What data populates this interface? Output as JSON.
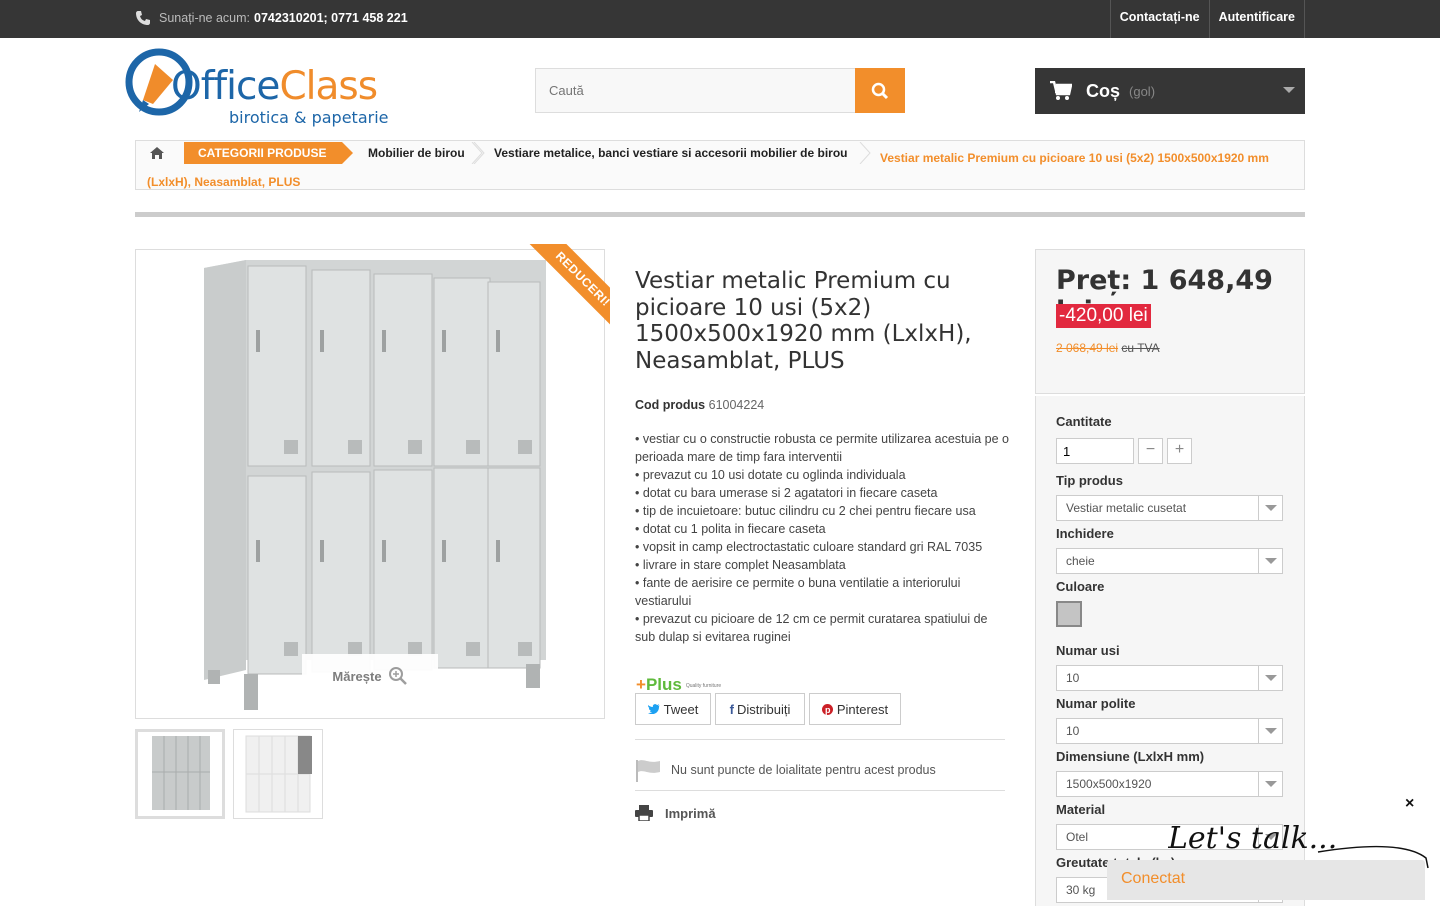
{
  "topbar": {
    "call_label": "Sunați-ne acum:",
    "phones": "0742310201; 0771 458 221",
    "contact_link": "Contactați-ne",
    "login_link": "Autentificare"
  },
  "logo": {
    "office": "Office",
    "class": "Class",
    "tagline": "birotica & papetarie"
  },
  "search": {
    "placeholder": "Caută"
  },
  "cart": {
    "label": "Coș",
    "count": "(gol)"
  },
  "breadcrumb": {
    "categories": "CATEGORII PRODUSE",
    "item1": "Mobilier de birou",
    "item2": "Vestiare metalice, banci vestiare si accesorii mobilier de birou",
    "current": "Vestiar metalic Premium cu picioare 10 usi (5x2) 1500x500x1920 mm (LxlxH), Neasamblat, PLUS"
  },
  "gallery": {
    "ribbon": "REDUCERI!",
    "zoom_label": "Mărește"
  },
  "product": {
    "title": "Vestiar metalic Premium cu picioare 10 usi (5x2) 1500x500x1920 mm (LxlxH), Neasamblat, PLUS",
    "code_label": "Cod produs",
    "code_value": "61004224",
    "description": [
      "• vestiar cu o constructie robusta ce permite utilizarea acestuia pe o perioada mare de timp fara interventii",
      "• prevazut cu 10 usi dotate cu oglinda individuala",
      "• dotat cu bara umerase si 2 agatatori in fiecare caseta",
      "• tip de incuietoare: butuc cilindru cu 2 chei pentru fiecare usa",
      "• dotat cu 1 polita in fiecare caseta",
      "• vopsit in camp electroctastatic culoare standard gri RAL 7035",
      "• livrare in stare complet Neasamblata",
      "• fante de aerisire ce permite o buna ventilatie a interiorului vestiarului",
      "• prevazut cu picioare de 12 cm ce permit curatarea spatiului de sub dulap si evitarea ruginei"
    ],
    "brand_logo": "Plus",
    "brand_tagline": "Quality furniture",
    "share": {
      "tweet": "Tweet",
      "share": "Distribuiți",
      "pinterest": "Pinterest"
    },
    "loyalty_text": "Nu sunt puncte de loialitate pentru acest produs",
    "print_label": "Imprimă"
  },
  "price": {
    "current": "Preț: 1 648,49 lei",
    "discount": "-420,00 lei",
    "old": "2 068,49 lei",
    "vat": "cu TVA"
  },
  "options": {
    "quantity_label": "Cantitate",
    "quantity_value": "1",
    "tip_label": "Tip produs",
    "tip_value": "Vestiar metalic cusetat",
    "inchidere_label": "Inchidere",
    "inchidere_value": "cheie",
    "culoare_label": "Culoare",
    "culoare_swatch": "#c4c4c4",
    "usi_label": "Numar usi",
    "usi_value": "10",
    "polite_label": "Numar polite",
    "polite_value": "10",
    "dim_label": "Dimensiune (LxlxH mm)",
    "dim_value": "1500x500x1920",
    "material_label": "Material",
    "material_value": "Otel",
    "greutate_label": "Greutate totala (kg)",
    "greutate_value": "30 kg"
  },
  "chat": {
    "script": "Let's talk...",
    "status": "Conectat",
    "close": "×"
  },
  "colors": {
    "accent": "#f28e2b",
    "dark": "#363636",
    "discount": "#e2293f",
    "logo_blue": "#1d66a8"
  }
}
